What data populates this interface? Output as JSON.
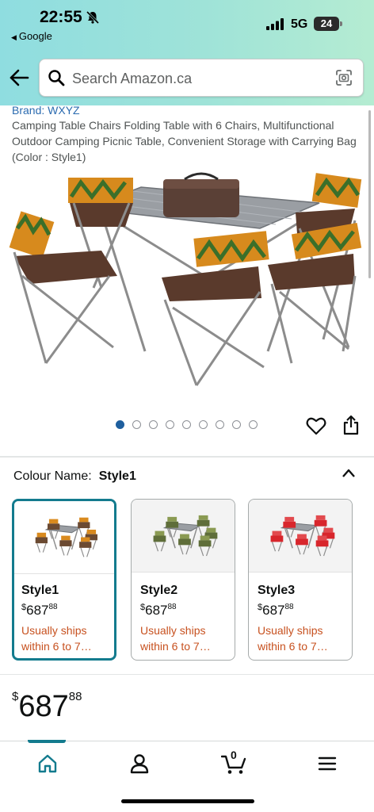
{
  "status_bar": {
    "time": "22:55",
    "back_app": "Google",
    "network": "5G",
    "battery": "24"
  },
  "search": {
    "placeholder": "Search Amazon.ca"
  },
  "product": {
    "brand": "Brand: WXYZ",
    "title": "Camping Table Chairs Folding Table with 6 Chairs, Multifunctional Outdoor Camping Picnic Table, Convenient Storage with Carrying Bag (Color : Style1)",
    "image_count": 9,
    "active_image_index": 0
  },
  "colour": {
    "label": "Colour Name:",
    "value": "Style1"
  },
  "styles": [
    {
      "name": "Style1",
      "currency": "$",
      "whole": "687",
      "fraction": "88",
      "shipping": "Usually ships within 6 to 7…",
      "selected": true,
      "chair_color": "#6b4a32",
      "accent_color": "#d98a1e"
    },
    {
      "name": "Style2",
      "currency": "$",
      "whole": "687",
      "fraction": "88",
      "shipping": "Usually ships within 6 to 7…",
      "selected": false,
      "chair_color": "#5f6e3a",
      "accent_color": "#8a9a52"
    },
    {
      "name": "Style3",
      "currency": "$",
      "whole": "687",
      "fraction": "88",
      "shipping": "Usually ships within 6 to 7…",
      "selected": false,
      "chair_color": "#d8262c",
      "accent_color": "#e24a4e"
    }
  ],
  "price": {
    "currency": "$",
    "whole": "687",
    "fraction": "88"
  },
  "nav": {
    "cart_count": "0",
    "items": [
      "home-icon",
      "account-icon",
      "cart-icon",
      "menu-icon"
    ]
  },
  "colors": {
    "accent": "#137b8e",
    "link": "#2b6bb0",
    "shipping": "#c7511f"
  }
}
